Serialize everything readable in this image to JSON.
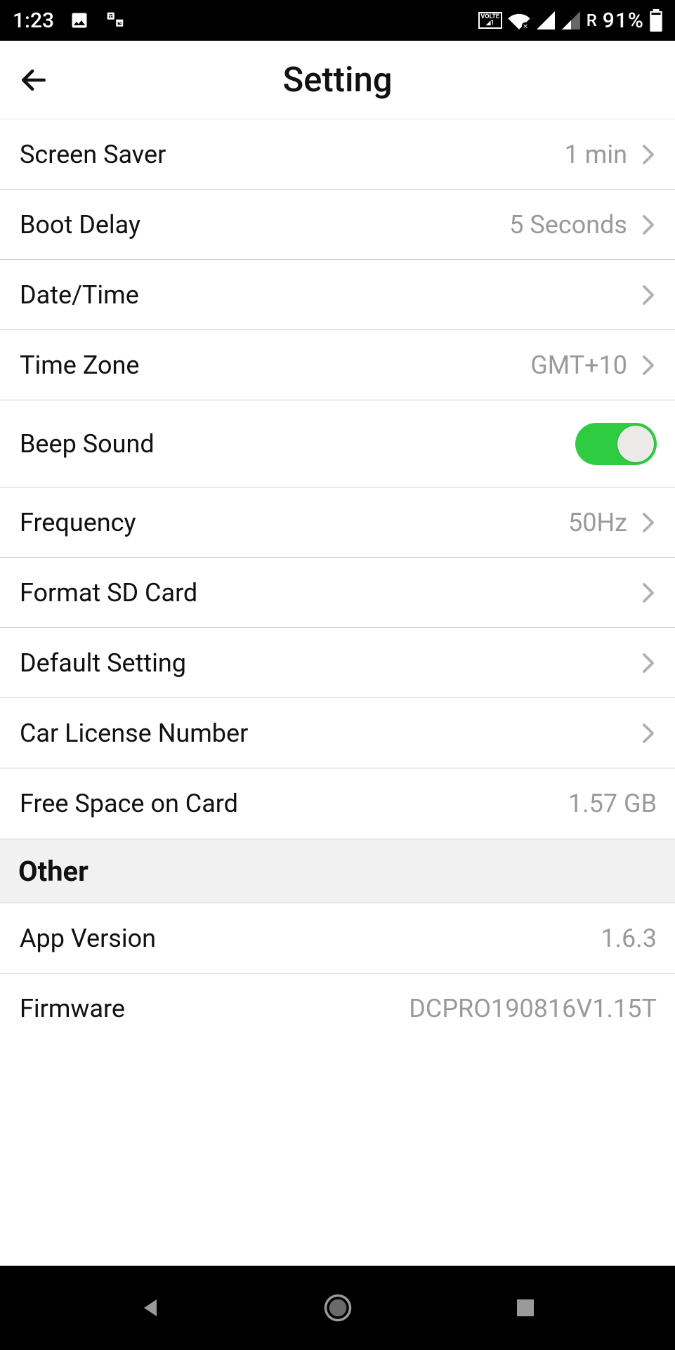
{
  "status": {
    "time": "1:23",
    "roaming": "R",
    "battery_pct": "91%"
  },
  "header": {
    "title": "Setting"
  },
  "rows": {
    "screen_saver": {
      "label": "Screen Saver",
      "value": "1 min"
    },
    "boot_delay": {
      "label": "Boot Delay",
      "value": "5 Seconds"
    },
    "date_time": {
      "label": "Date/Time",
      "value": ""
    },
    "time_zone": {
      "label": "Time Zone",
      "value": "GMT+10"
    },
    "beep_sound": {
      "label": "Beep Sound",
      "on": true
    },
    "frequency": {
      "label": "Frequency",
      "value": "50Hz"
    },
    "format_sd": {
      "label": "Format SD Card",
      "value": ""
    },
    "default_setting": {
      "label": "Default Setting",
      "value": ""
    },
    "car_license": {
      "label": "Car License Number",
      "value": ""
    },
    "free_space": {
      "label": "Free Space on Card",
      "value": "1.57 GB"
    }
  },
  "section": {
    "other": "Other"
  },
  "info": {
    "app_version": {
      "label": "App Version",
      "value": "1.6.3"
    },
    "firmware": {
      "label": "Firmware",
      "value": "DCPRO190816V1.15T"
    }
  }
}
